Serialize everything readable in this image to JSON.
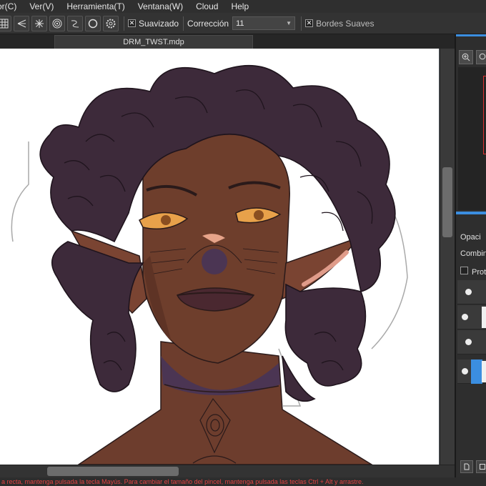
{
  "menubar": {
    "items": [
      "or(C)",
      "Ver(V)",
      "Herramienta(T)",
      "Ventana(W)",
      "Cloud",
      "Help"
    ]
  },
  "toolbar": {
    "suavizado_label": "Suavizado",
    "suavizado_checked": "✕",
    "correccion_label": "Corrección",
    "correccion_value": "11",
    "bordes_label": "Bordes Suaves",
    "bordes_checked": "✕"
  },
  "document": {
    "tab_title": "DRM_TWST.mdp"
  },
  "right_panel": {
    "opacidad_label": "Opaci",
    "combinar_label": "Combina",
    "proteger_label": "Prot"
  },
  "status": {
    "text": "a recta, mantenga pulsada la tecla Mayús. Para cambiar el tamaño del pincel, mantenga pulsada las teclas Ctrl + Alt y arrastre."
  },
  "icons": {
    "toolbar": [
      "grid-icon",
      "ruler-perspective-icon",
      "ruler-radial-icon",
      "ruler-concentric-icon",
      "ruler-curve-icon",
      "ruler-circle-icon",
      "settings-icon"
    ]
  },
  "colors": {
    "accent": "#3b8ee0",
    "status_text": "#e24343",
    "hair": "#3d2a3a",
    "skin": "#6e3e2c"
  }
}
